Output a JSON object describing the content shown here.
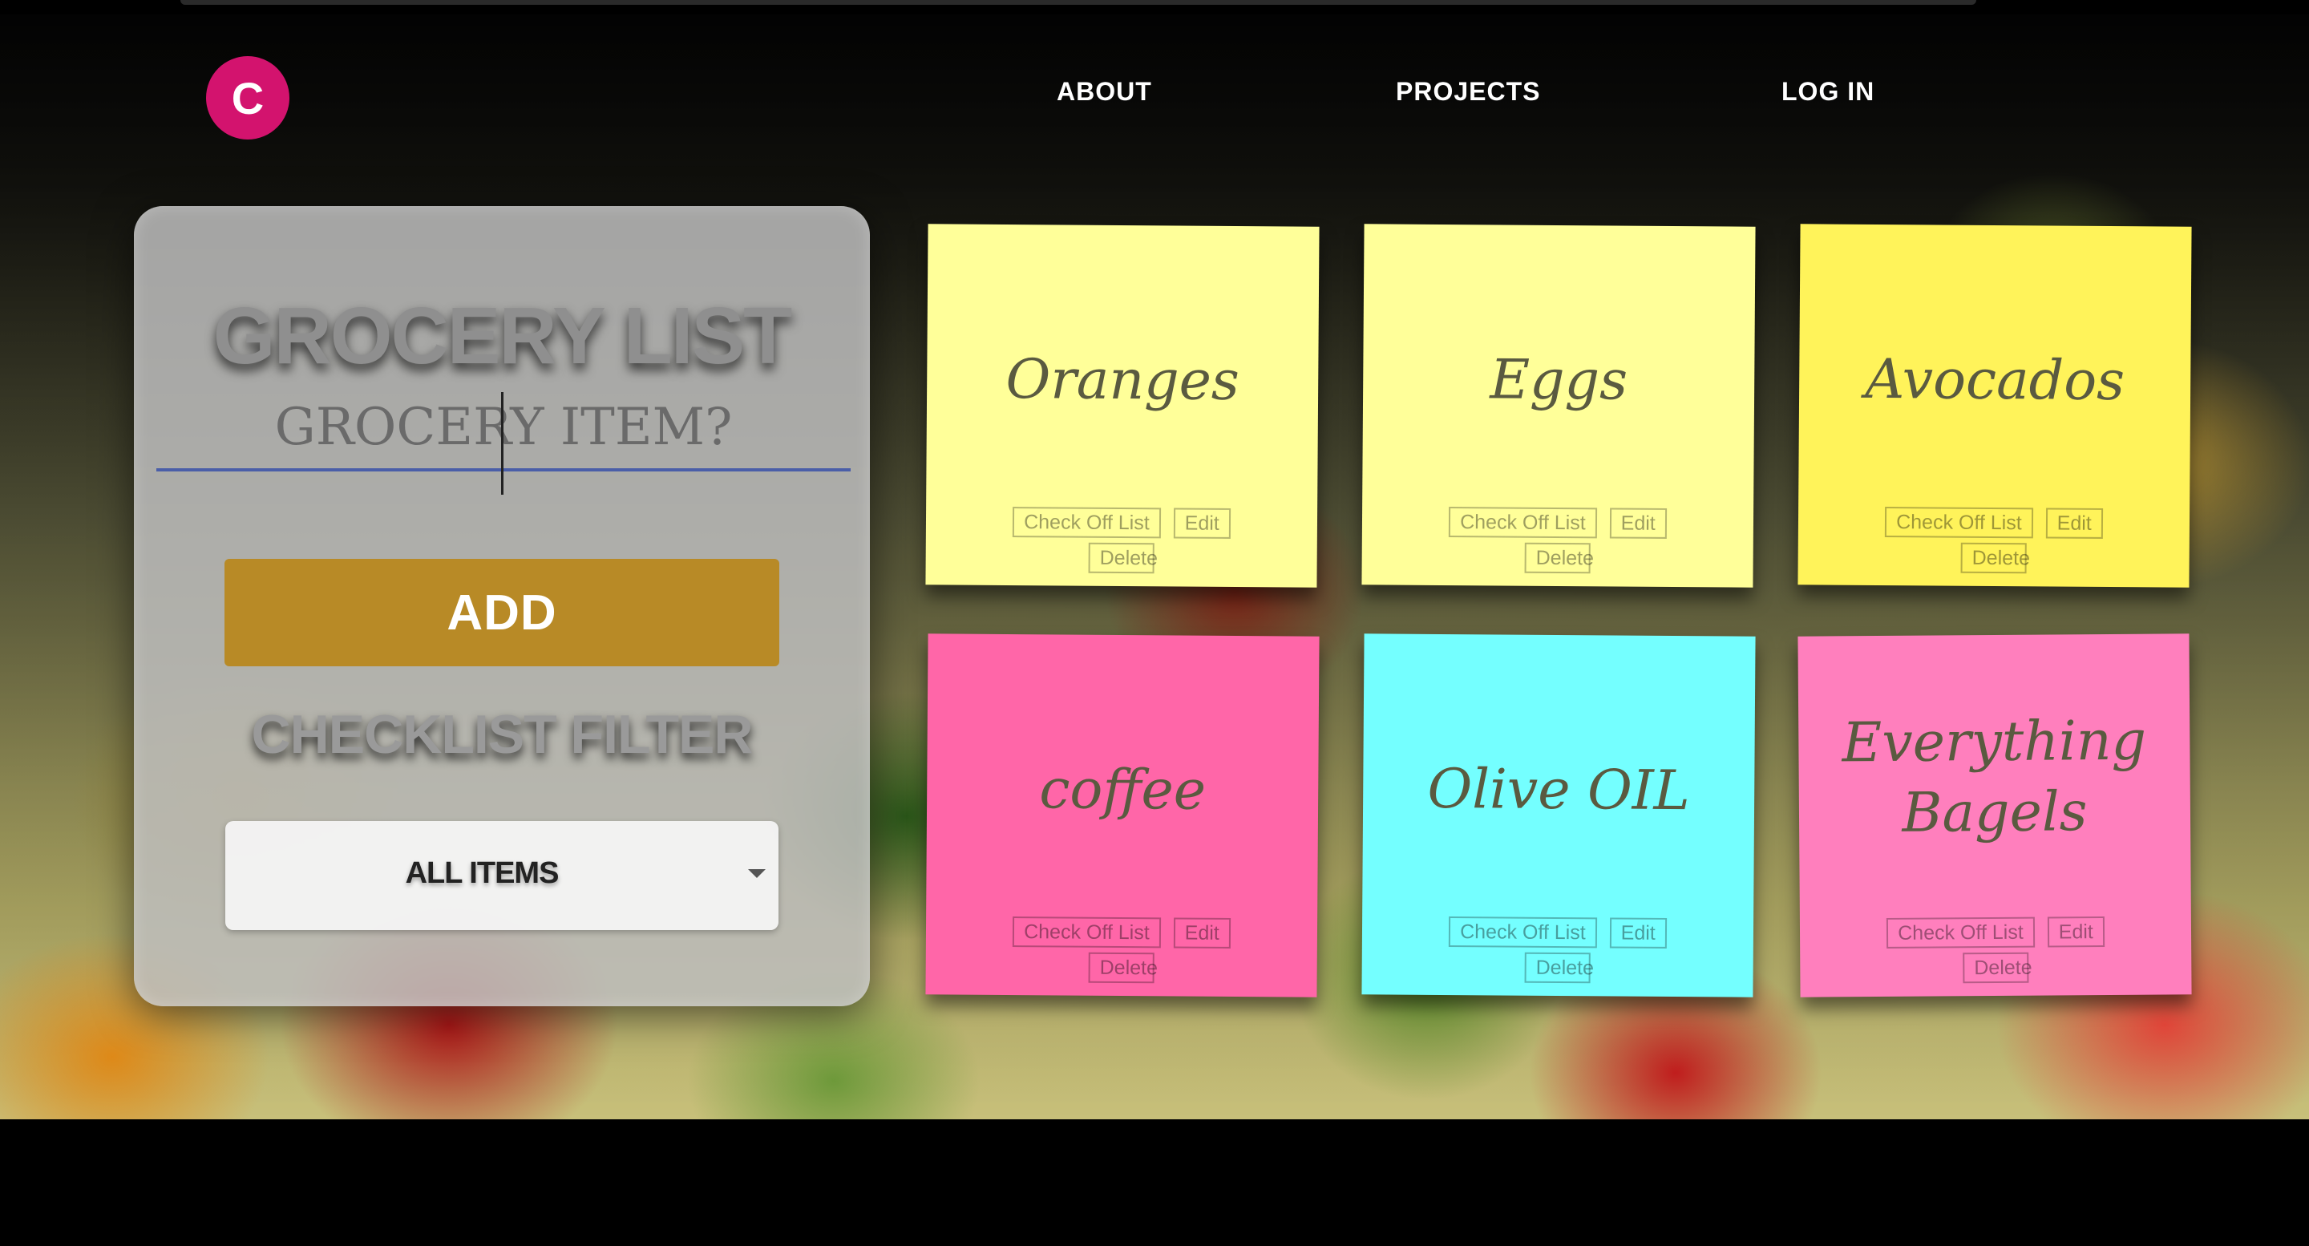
{
  "nav": {
    "logo_letter": "C",
    "links": [
      "ABOUT",
      "PROJECTS",
      "LOG IN"
    ]
  },
  "panel": {
    "title": "GROCERY LIST",
    "input_placeholder": "GROCERY ITEM?",
    "add_label": "ADD",
    "filter_title": "CHECKLIST FILTER",
    "filter_value": "ALL ITEMS"
  },
  "notes": [
    {
      "text": "Oranges",
      "color": "#ffff99"
    },
    {
      "text": "Eggs",
      "color": "#ffff99"
    },
    {
      "text": "Avocados",
      "color": "#fff35a"
    },
    {
      "text": "coffee",
      "color": "#ff66a8"
    },
    {
      "text": "Olive OIL",
      "color": "#74ffff"
    },
    {
      "text": "Everything Bagels",
      "color": "#ff7fbd"
    }
  ],
  "note_buttons": {
    "check_off": "Check Off List",
    "edit": "Edit",
    "delete": "Delete"
  },
  "colors": {
    "logo": "#d3136e",
    "add_button": "#b88a26",
    "input_underline": "#4a5ea8"
  }
}
